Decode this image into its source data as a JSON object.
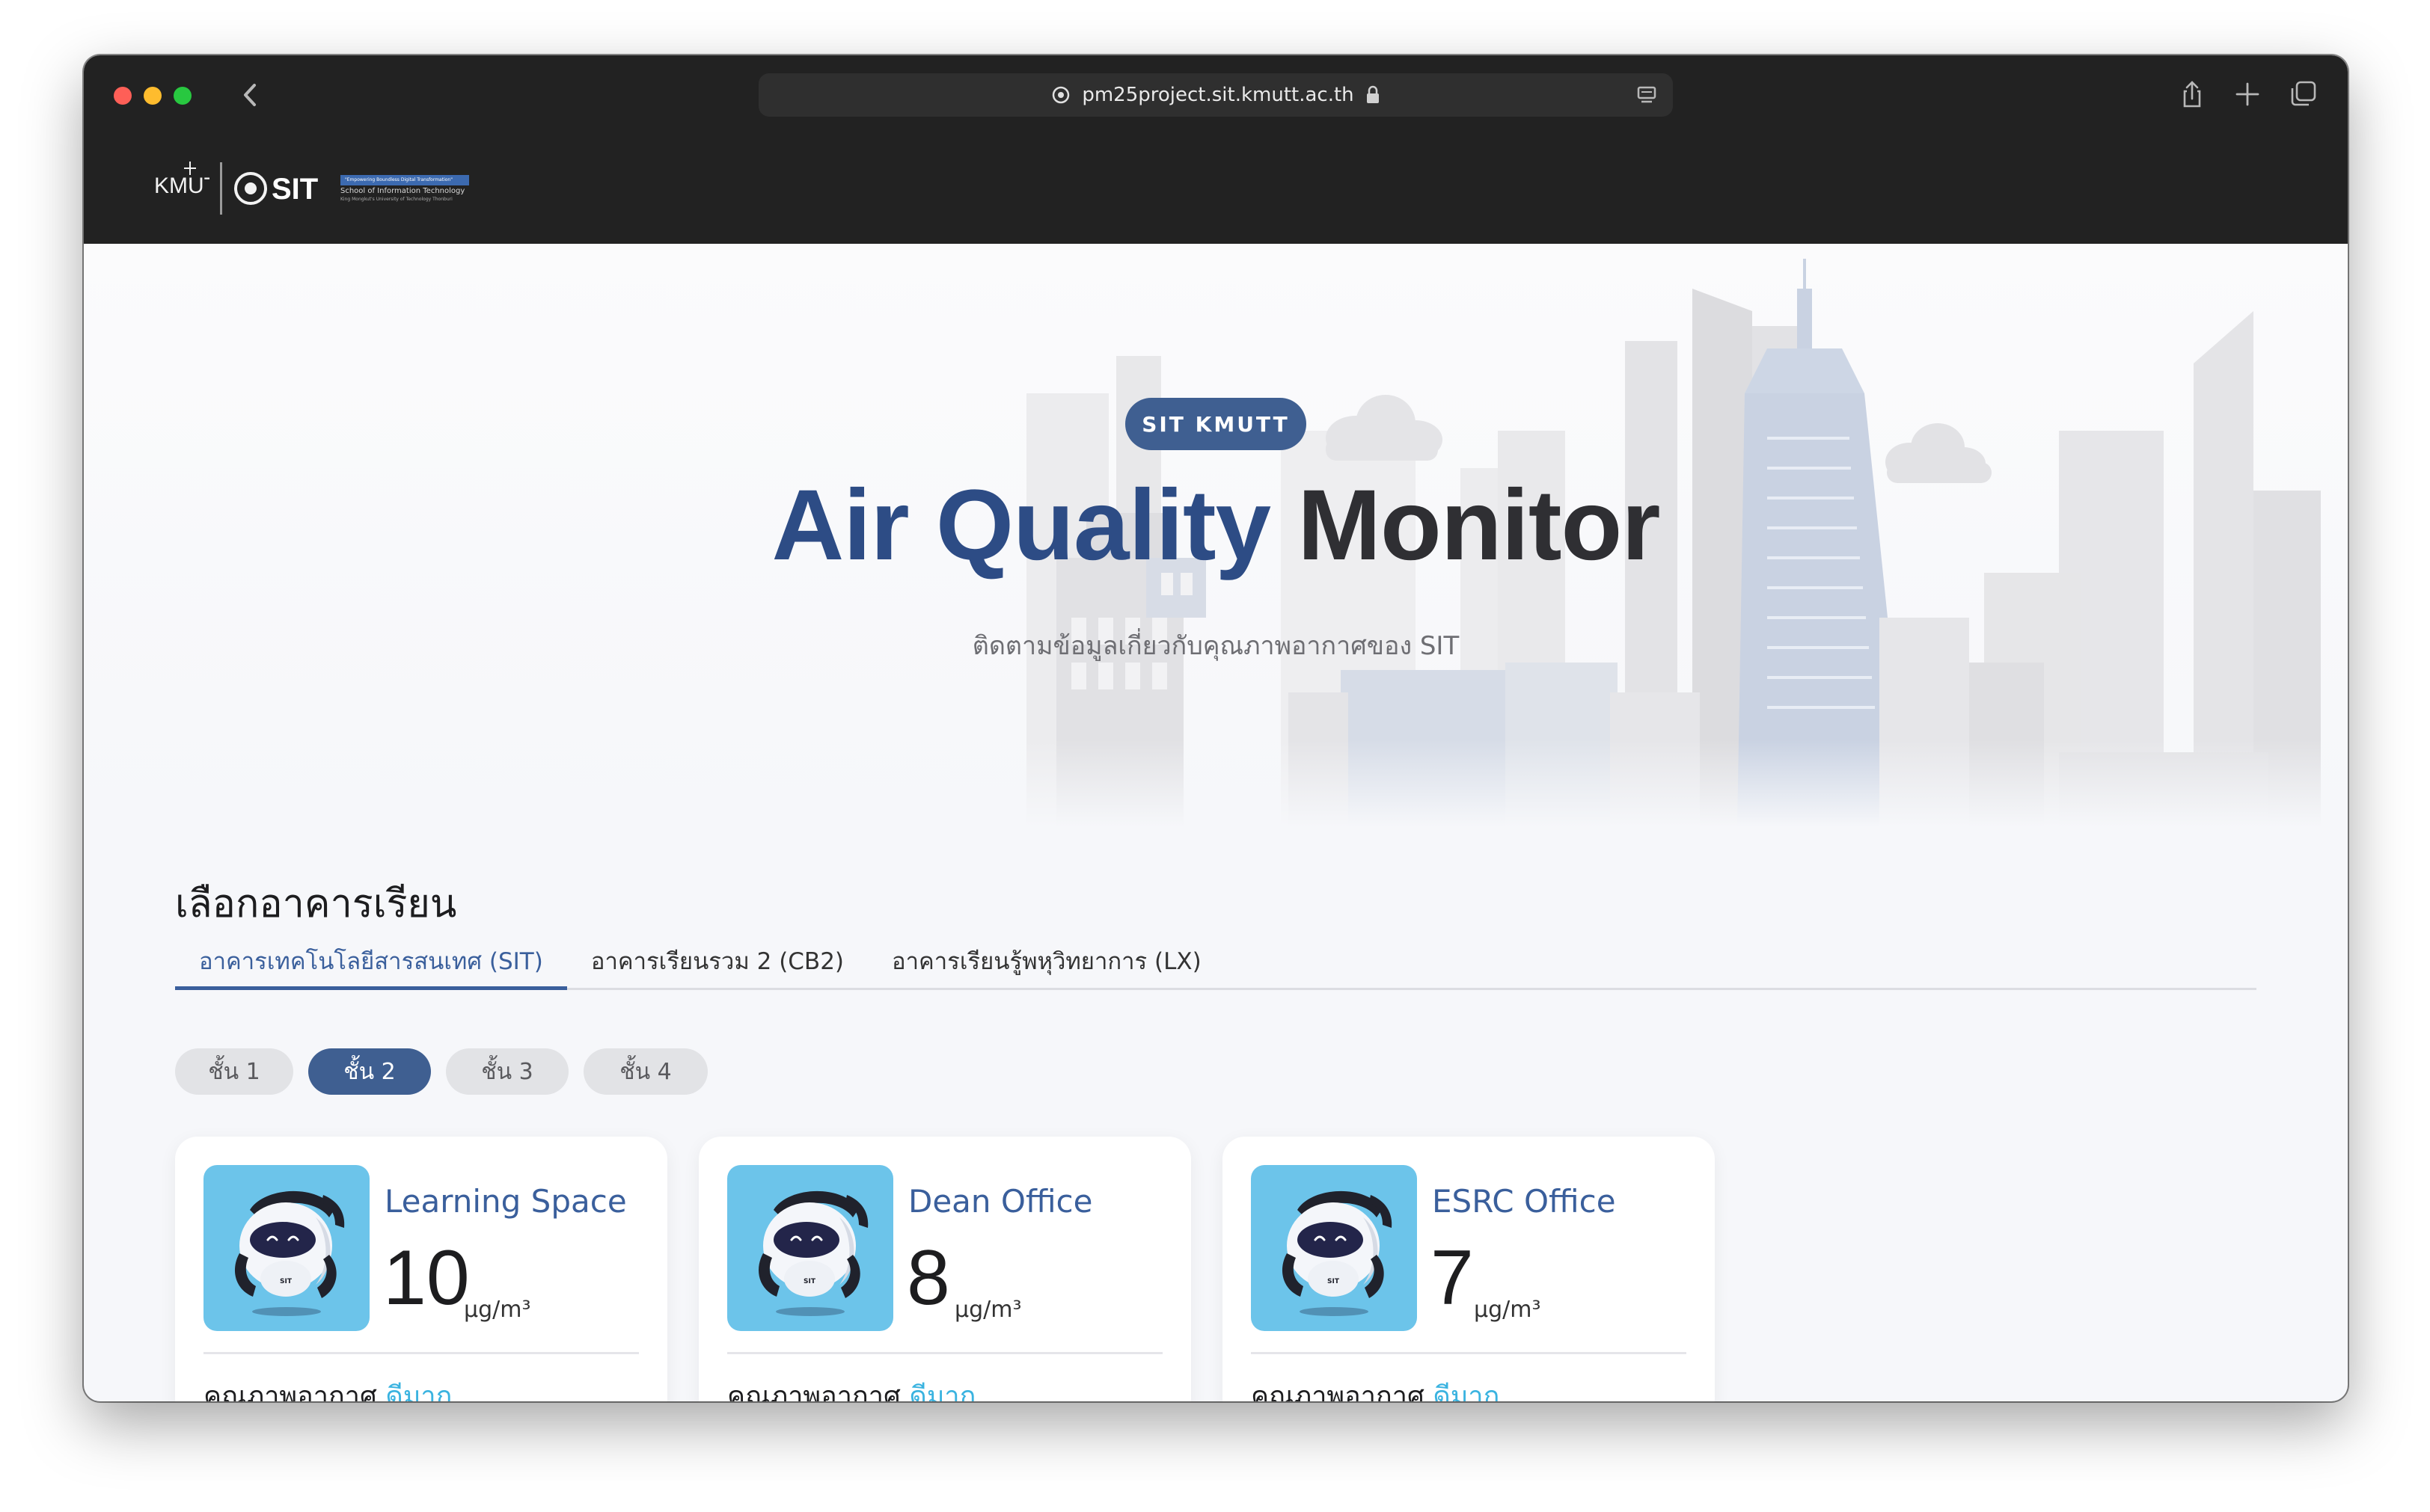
{
  "browser": {
    "url": "pm25project.sit.kmutt.ac.th"
  },
  "header": {
    "logo_kmutt": "KMUTT",
    "logo_sit": "SIT",
    "sit_tagline": "\"Empowering Boundless Digital Transformation\"",
    "sit_name": "School of Information Technology",
    "sit_university": "King Mongkut's University of Technology Thonburi"
  },
  "hero": {
    "badge": "SIT KMUTT",
    "title_accent": "Air Quality",
    "title_rest": "Monitor",
    "subtitle": "ติดตามข้อมูลเกี่ยวกับคุณภาพอากาศของ SIT"
  },
  "section": {
    "title": "เลือกอาคารเรียน"
  },
  "buildings": [
    {
      "label": "อาคารเทคโนโลยีสารสนเทศ (SIT)",
      "active": true
    },
    {
      "label": "อาคารเรียนรวม 2 (CB2)",
      "active": false
    },
    {
      "label": "อาคารเรียนรู้พหุวิทยาการ (LX)",
      "active": false
    }
  ],
  "floors": [
    {
      "label": "ชั้น 1",
      "active": false
    },
    {
      "label": "ชั้น 2",
      "active": true
    },
    {
      "label": "ชั้น 3",
      "active": false
    },
    {
      "label": "ชั้น 4",
      "active": false
    }
  ],
  "rooms": [
    {
      "name": "Learning Space",
      "value": "10",
      "unit": "µg/m³",
      "quality_label": "คุณภาพอากาศ",
      "quality": "ดีมาก"
    },
    {
      "name": "Dean Office",
      "value": "8",
      "unit": "µg/m³",
      "quality_label": "คุณภาพอากาศ",
      "quality": "ดีมาก"
    },
    {
      "name": "ESRC Office",
      "value": "7",
      "unit": "µg/m³",
      "quality_label": "คุณภาพอากาศ",
      "quality": "ดีมาก"
    }
  ],
  "mascot": {
    "chest_text": "SIT"
  },
  "colors": {
    "brand": "#3f5f91",
    "accent_text": "#2d4c85",
    "quality_good": "#3ab3e0",
    "card_image_bg": "#6cc4ea"
  }
}
